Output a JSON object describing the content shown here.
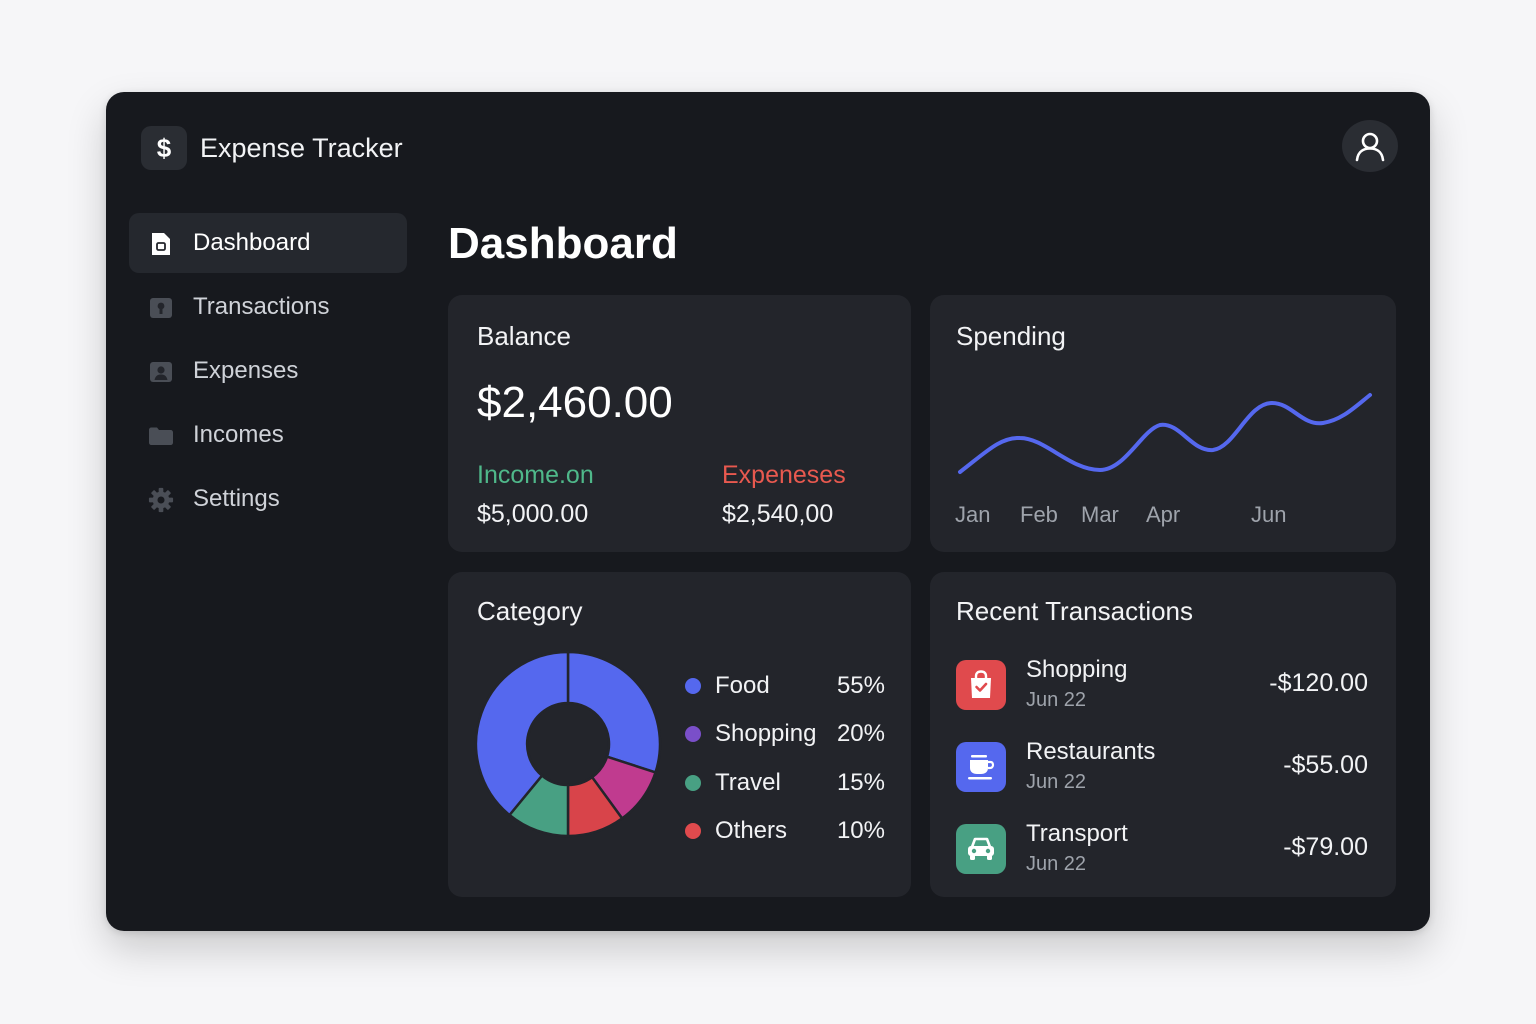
{
  "app": {
    "title": "Expense Tracker",
    "logo_symbol": "$",
    "logo_icon": "dollar-icon",
    "user_icon": "user-icon"
  },
  "sidebar": {
    "items": [
      {
        "label": "Dashboard",
        "icon": "dashboard-icon",
        "active": true
      },
      {
        "label": "Transactions",
        "icon": "transactions-icon",
        "active": false
      },
      {
        "label": "Expenses",
        "icon": "expenses-icon",
        "active": false
      },
      {
        "label": "Incomes",
        "icon": "folder-icon",
        "active": false
      },
      {
        "label": "Settings",
        "icon": "gear-icon",
        "active": false
      }
    ]
  },
  "main": {
    "title": "Dashboard"
  },
  "balance": {
    "title": "Balance",
    "amount": "$2,460.00",
    "income_label": "Income.on",
    "income_value": "$5,000.00",
    "expenses_label": "Expeneses",
    "expenses_value": "$2,540,00",
    "income_color": "#4fb88a",
    "expenses_color": "#e8594f"
  },
  "spending": {
    "title": "Spending",
    "months": [
      "Jan",
      "Feb",
      "Mar",
      "Apr",
      "Jun"
    ],
    "line_color": "#5568ee"
  },
  "category": {
    "title": "Category",
    "items": [
      {
        "name": "Food",
        "percent": "55%",
        "color": "#5568ee"
      },
      {
        "name": "Shopping",
        "percent": "20%",
        "color": "#7a4fc9"
      },
      {
        "name": "Travel",
        "percent": "15%",
        "color": "#48a083"
      },
      {
        "name": "Others",
        "percent": "10%",
        "color": "#e04a4d"
      }
    ],
    "donut_colors": [
      "#5568ee",
      "#c03b8f",
      "#d8444a",
      "#48a083"
    ]
  },
  "recent": {
    "title": "Recent Transactions",
    "items": [
      {
        "name": "Shopping",
        "date": "Jun 22",
        "amount": "-$120.00",
        "icon": "shopping-bag-icon",
        "color": "#e04a4d"
      },
      {
        "name": "Restaurants",
        "date": "Jun 22",
        "amount": "-$55.00",
        "icon": "coffee-cup-icon",
        "color": "#5568ee"
      },
      {
        "name": "Transport",
        "date": "Jun 22",
        "amount": "-$79.00",
        "icon": "car-icon",
        "color": "#48a083"
      }
    ]
  }
}
